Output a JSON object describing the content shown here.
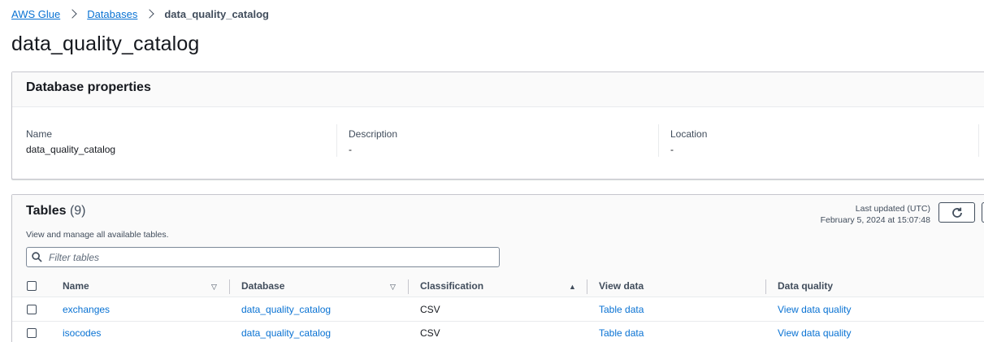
{
  "breadcrumb": {
    "items": [
      "AWS Glue",
      "Databases"
    ],
    "current": "data_quality_catalog"
  },
  "page_title": "data_quality_catalog",
  "properties": {
    "heading": "Database properties",
    "fields": [
      {
        "label": "Name",
        "value": "data_quality_catalog"
      },
      {
        "label": "Description",
        "value": "-"
      },
      {
        "label": "Location",
        "value": "-"
      }
    ]
  },
  "tables": {
    "title": "Tables",
    "count": "(9)",
    "description": "View and manage all available tables.",
    "last_updated_label": "Last updated (UTC)",
    "last_updated_value": "February 5, 2024 at 15:07:48",
    "filter_placeholder": "Filter tables",
    "columns": [
      "Name",
      "Database",
      "Classification",
      "View data",
      "Data quality"
    ],
    "rows": [
      {
        "name": "exchanges",
        "database": "data_quality_catalog",
        "classification": "CSV",
        "view_data": "Table data",
        "data_quality": "View data quality"
      },
      {
        "name": "isocodes",
        "database": "data_quality_catalog",
        "classification": "CSV",
        "view_data": "Table data",
        "data_quality": "View data quality"
      }
    ]
  },
  "colors": {
    "link": "#0972d3",
    "text": "#16191f",
    "muted": "#414d5c",
    "border": "#c6c6cd"
  }
}
